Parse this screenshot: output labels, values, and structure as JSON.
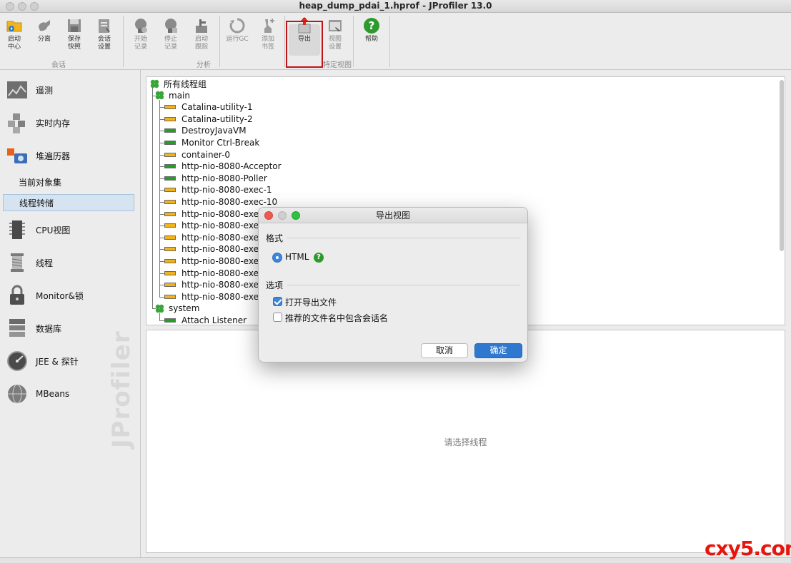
{
  "window": {
    "title": "heap_dump_pdai_1.hprof - JProfiler 13.0"
  },
  "toolbar": {
    "buttons": [
      {
        "label": "启动\n中心",
        "icon": "folder-play-icon"
      },
      {
        "label": "分离",
        "icon": "detach-plug-icon"
      },
      {
        "label": "保存\n快照",
        "icon": "save-disk-icon"
      },
      {
        "label": "会话\n设置",
        "icon": "session-settings-icon"
      },
      {
        "label": "开始\n记录",
        "icon": "start-recording-icon"
      },
      {
        "label": "停止\n记录",
        "icon": "stop-recording-icon"
      },
      {
        "label": "启动\n跟踪",
        "icon": "start-tracking-icon"
      },
      {
        "label": "运行GC",
        "icon": "run-gc-icon"
      },
      {
        "label": "添加\n书签",
        "icon": "add-bookmark-icon"
      },
      {
        "label": "导出",
        "icon": "export-icon"
      },
      {
        "label": "视图\n设置",
        "icon": "view-settings-icon"
      },
      {
        "label": "帮助",
        "icon": "help-icon"
      }
    ],
    "groups": {
      "session": "会话",
      "analysis": "分析",
      "view_specific": "特定视图"
    }
  },
  "sidebar": {
    "items": [
      {
        "label": "遥测",
        "icon": "telemetry-icon"
      },
      {
        "label": "实时内存",
        "icon": "live-memory-icon"
      },
      {
        "label": "堆遍历器",
        "icon": "heap-walker-icon"
      },
      {
        "label": "CPU视图",
        "icon": "cpu-chip-icon"
      },
      {
        "label": "线程",
        "icon": "threads-spool-icon"
      },
      {
        "label": "Monitor&锁",
        "icon": "lock-icon"
      },
      {
        "label": "数据库",
        "icon": "database-icon"
      },
      {
        "label": "JEE & 探针",
        "icon": "probe-gauge-icon"
      },
      {
        "label": "MBeans",
        "icon": "mbeans-globe-icon"
      }
    ],
    "sub_items": [
      {
        "label": "当前对象集"
      },
      {
        "label": "线程转储"
      }
    ],
    "watermark": "JProfiler"
  },
  "thread_tree": {
    "root": "所有线程组",
    "main_group": "main",
    "main_threads": [
      {
        "name": "Catalina-utility-1",
        "state": "waiting"
      },
      {
        "name": "Catalina-utility-2",
        "state": "waiting"
      },
      {
        "name": "DestroyJavaVM",
        "state": "runnable"
      },
      {
        "name": "Monitor Ctrl-Break",
        "state": "runnable"
      },
      {
        "name": "container-0",
        "state": "waiting"
      },
      {
        "name": "http-nio-8080-Acceptor",
        "state": "runnable"
      },
      {
        "name": "http-nio-8080-Poller",
        "state": "runnable"
      },
      {
        "name": "http-nio-8080-exec-1",
        "state": "waiting"
      },
      {
        "name": "http-nio-8080-exec-10",
        "state": "waiting"
      },
      {
        "name": "http-nio-8080-exe",
        "state": "waiting"
      },
      {
        "name": "http-nio-8080-exe",
        "state": "waiting"
      },
      {
        "name": "http-nio-8080-exe",
        "state": "waiting"
      },
      {
        "name": "http-nio-8080-exe",
        "state": "waiting"
      },
      {
        "name": "http-nio-8080-exe",
        "state": "waiting"
      },
      {
        "name": "http-nio-8080-exe",
        "state": "waiting"
      },
      {
        "name": "http-nio-8080-exe",
        "state": "waiting"
      },
      {
        "name": "http-nio-8080-exe",
        "state": "waiting"
      }
    ],
    "system_group": "system",
    "system_threads": [
      {
        "name": "Attach Listener",
        "state": "runnable"
      }
    ]
  },
  "detail": {
    "hint": "请选择线程"
  },
  "dialog": {
    "title": "导出视图",
    "format_section": "格式",
    "format_option": "HTML",
    "format_selected": true,
    "options_section": "选项",
    "option_open_file": {
      "label": "打开导出文件",
      "checked": true
    },
    "option_session_name": {
      "label": "推荐的文件名中包含会话名",
      "checked": false
    },
    "cancel_label": "取消",
    "ok_label": "确定"
  },
  "corner_mark": "cxy5.com",
  "colors": {
    "runnable": "#22a022",
    "waiting": "#f2b31a",
    "highlight": "#c0141a",
    "accent": "#2f78cf"
  }
}
